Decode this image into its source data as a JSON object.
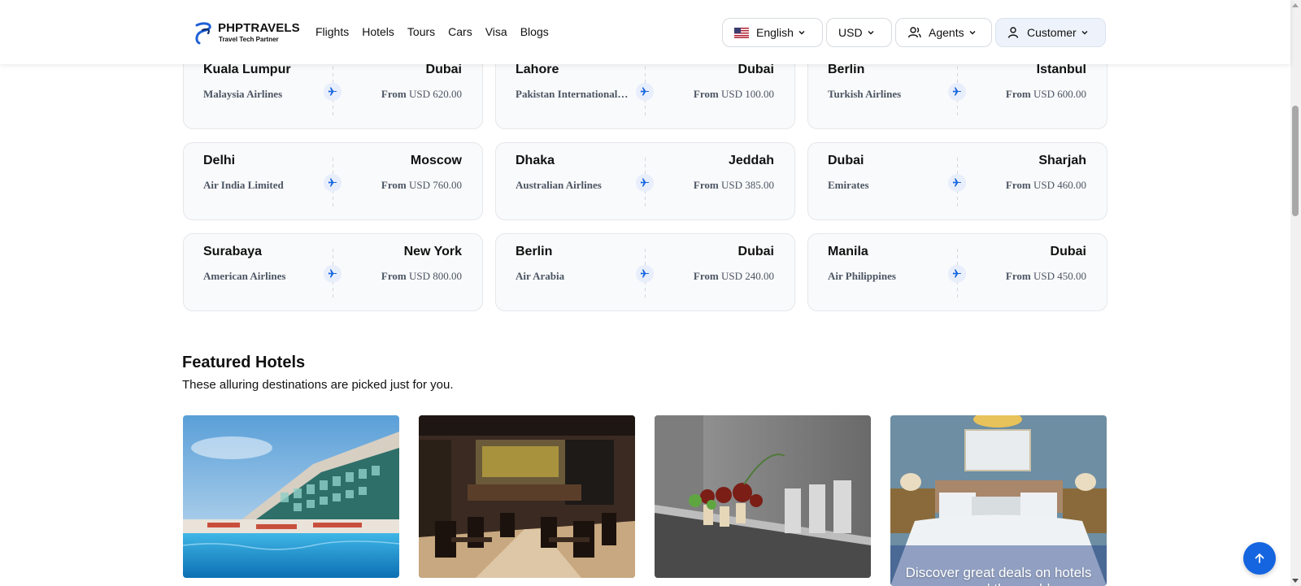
{
  "brand": {
    "title": "PHPTRAVELS",
    "subtitle": "Travel Tech Partner"
  },
  "nav": [
    "Flights",
    "Hotels",
    "Tours",
    "Cars",
    "Visa",
    "Blogs"
  ],
  "header_controls": {
    "language": "English",
    "currency": "USD",
    "agents": "Agents",
    "customer": "Customer"
  },
  "flights": [
    {
      "from": "Kuala Lumpur",
      "to": "Dubai",
      "airline": "Malaysia Airlines",
      "from_label": "From",
      "price": "USD 620.00"
    },
    {
      "from": "Lahore",
      "to": "Dubai",
      "airline": "Pakistan International Airlines",
      "from_label": "From",
      "price": "USD 100.00"
    },
    {
      "from": "Berlin",
      "to": "Istanbul",
      "airline": "Turkish Airlines",
      "from_label": "From",
      "price": "USD 600.00"
    },
    {
      "from": "Delhi",
      "to": "Moscow",
      "airline": "Air India Limited",
      "from_label": "From",
      "price": "USD 760.00"
    },
    {
      "from": "Dhaka",
      "to": "Jeddah",
      "airline": "Australian Airlines",
      "from_label": "From",
      "price": "USD 385.00"
    },
    {
      "from": "Dubai",
      "to": "Sharjah",
      "airline": "Emirates",
      "from_label": "From",
      "price": "USD 460.00"
    },
    {
      "from": "Surabaya",
      "to": "New York",
      "airline": "American Airlines",
      "from_label": "From",
      "price": "USD 800.00"
    },
    {
      "from": "Berlin",
      "to": "Dubai",
      "airline": "Air Arabia",
      "from_label": "From",
      "price": "USD 240.00"
    },
    {
      "from": "Manila",
      "to": "Dubai",
      "airline": "Air Philippines",
      "from_label": "From",
      "price": "USD 450.00"
    }
  ],
  "featured_hotels": {
    "title": "Featured Hotels",
    "subtitle": "These alluring destinations are picked just for you.",
    "promo_text": "Discover great deals on hotels around the world"
  },
  "colors": {
    "accent": "#1565e0",
    "card_bg": "#f9fafb"
  }
}
